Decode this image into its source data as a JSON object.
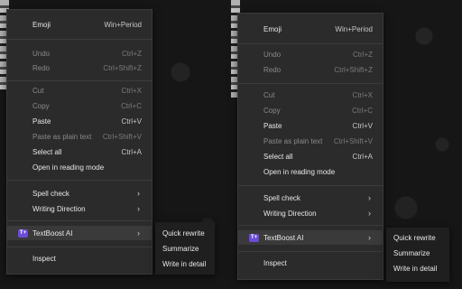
{
  "menu": {
    "emoji": {
      "label": "Emoji",
      "shortcut": "Win+Period"
    },
    "undo": {
      "label": "Undo",
      "shortcut": "Ctrl+Z"
    },
    "redo": {
      "label": "Redo",
      "shortcut": "Ctrl+Shift+Z"
    },
    "cut": {
      "label": "Cut",
      "shortcut": "Ctrl+X"
    },
    "copy": {
      "label": "Copy",
      "shortcut": "Ctrl+C"
    },
    "paste": {
      "label": "Paste",
      "shortcut": "Ctrl+V"
    },
    "paste_plain": {
      "label": "Paste as plain text",
      "shortcut": "Ctrl+Shift+V"
    },
    "select_all": {
      "label": "Select all",
      "shortcut": "Ctrl+A"
    },
    "reading_mode": {
      "label": "Open in reading mode"
    },
    "spell_check": {
      "label": "Spell check"
    },
    "writing_direction": {
      "label": "Writing Direction"
    },
    "textboost": {
      "label": "TextBoost AI",
      "icon_text": "T+"
    },
    "inspect": {
      "label": "Inspect"
    }
  },
  "submenu": {
    "quick_rewrite": "Quick rewrite",
    "summarize": "Summarize",
    "write_in_detail": "Write in detail"
  },
  "colors": {
    "accent": "#6b4bd8",
    "menu_bg": "#2b2b2b",
    "submenu_bg": "#1f1f1f"
  }
}
